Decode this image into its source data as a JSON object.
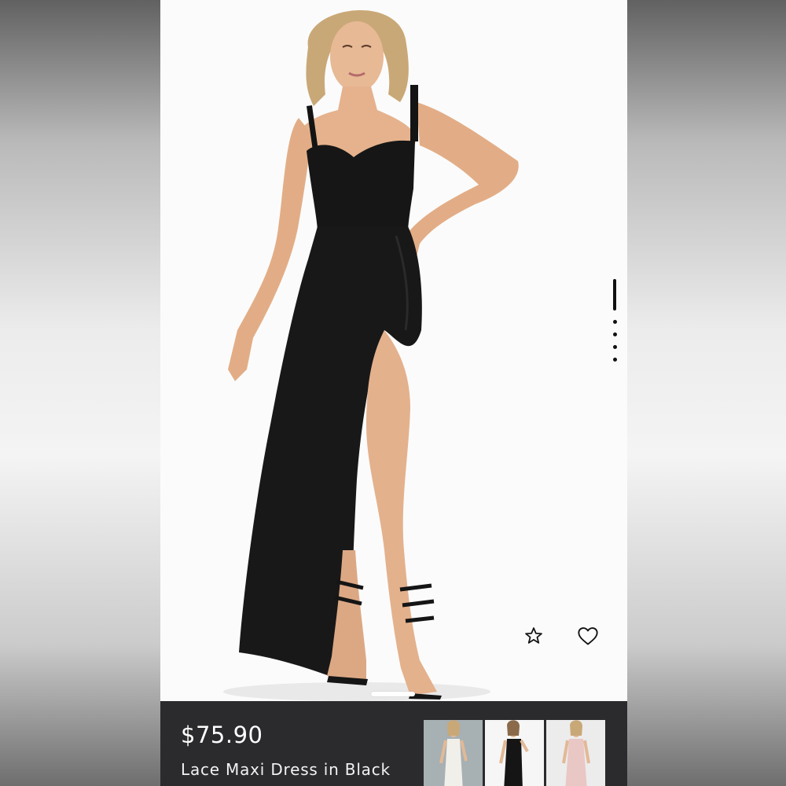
{
  "product": {
    "price": "$75.90",
    "name": "Lace Maxi Dress in Black"
  },
  "actions": {
    "favorite_icon": "star-icon",
    "wishlist_icon": "heart-icon"
  },
  "gallery": {
    "image_count": 5,
    "active_index": 0
  },
  "thumbnails": [
    {
      "color": "white",
      "background": "#9aa4a8",
      "dress_color": "#f1efe9"
    },
    {
      "color": "black",
      "background": "#f4f4f4",
      "dress_color": "#151515"
    },
    {
      "color": "pink",
      "background": "#e6e6e6",
      "dress_color": "#e9c7c4"
    }
  ],
  "colors": {
    "info_bar": "#2b2b2e",
    "text": "#ffffff",
    "accent": "#111111"
  }
}
